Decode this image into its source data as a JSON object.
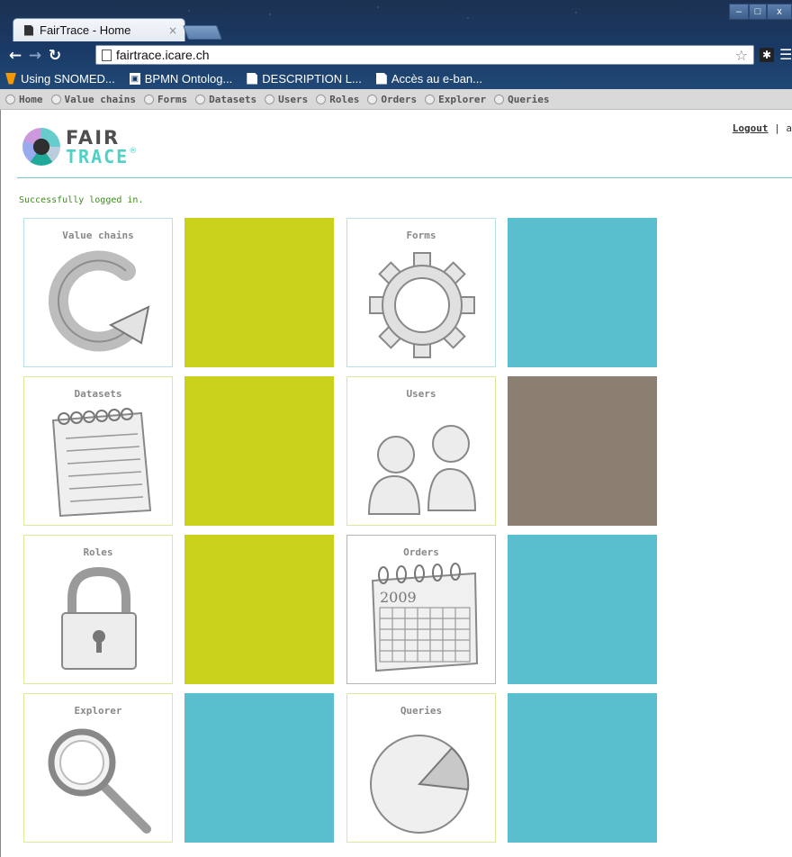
{
  "browser": {
    "tab_title": "FairTrace - Home",
    "tab_close": "×",
    "url": "fairtrace.icare.ch",
    "window_controls": {
      "minimize": "–",
      "maximize": "□",
      "close": "x"
    },
    "bookmarks": [
      {
        "label": "Using SNOMED...",
        "icon": "typo3-icon"
      },
      {
        "label": "BPMN Ontolog...",
        "icon": "bpmn-icon"
      },
      {
        "label": "DESCRIPTION L...",
        "icon": "document-icon"
      },
      {
        "label": "Accès au e-ban...",
        "icon": "document-icon"
      }
    ]
  },
  "menu": [
    {
      "label": "Home",
      "icon": "home-icon"
    },
    {
      "label": "Value chains",
      "icon": "value-chains-icon"
    },
    {
      "label": "Forms",
      "icon": "forms-icon"
    },
    {
      "label": "Datasets",
      "icon": "datasets-icon"
    },
    {
      "label": "Users",
      "icon": "users-icon"
    },
    {
      "label": "Roles",
      "icon": "roles-icon"
    },
    {
      "label": "Orders",
      "icon": "orders-icon"
    },
    {
      "label": "Explorer",
      "icon": "explorer-icon"
    },
    {
      "label": "Queries",
      "icon": "queries-icon"
    }
  ],
  "header": {
    "logo_word_1": "FAIR",
    "logo_word_2": "TRACE",
    "logo_mark": "®",
    "logout_label": "Logout",
    "user_separator": "| a"
  },
  "flash_message": "Successfully logged in.",
  "tiles": [
    {
      "label": "Value chains",
      "icon": "circular-arrow-icon",
      "swatch_color": "#c9d11a"
    },
    {
      "label": "Forms",
      "icon": "gear-icon",
      "swatch_color": "#59bfcf"
    },
    {
      "label": "Datasets",
      "icon": "notepad-icon",
      "swatch_color": "#c9d11a"
    },
    {
      "label": "Users",
      "icon": "users-icon",
      "swatch_color": "#8a7f70"
    },
    {
      "label": "Roles",
      "icon": "padlock-icon",
      "swatch_color": "#c9d11a"
    },
    {
      "label": "Orders",
      "icon": "calendar-icon",
      "swatch_color": "#59bfcf",
      "calendar_year": "2009"
    },
    {
      "label": "Explorer",
      "icon": "magnifier-icon",
      "swatch_color": "#59bfcf"
    },
    {
      "label": "Queries",
      "icon": "pie-chart-icon",
      "swatch_color": "#59bfcf"
    }
  ]
}
